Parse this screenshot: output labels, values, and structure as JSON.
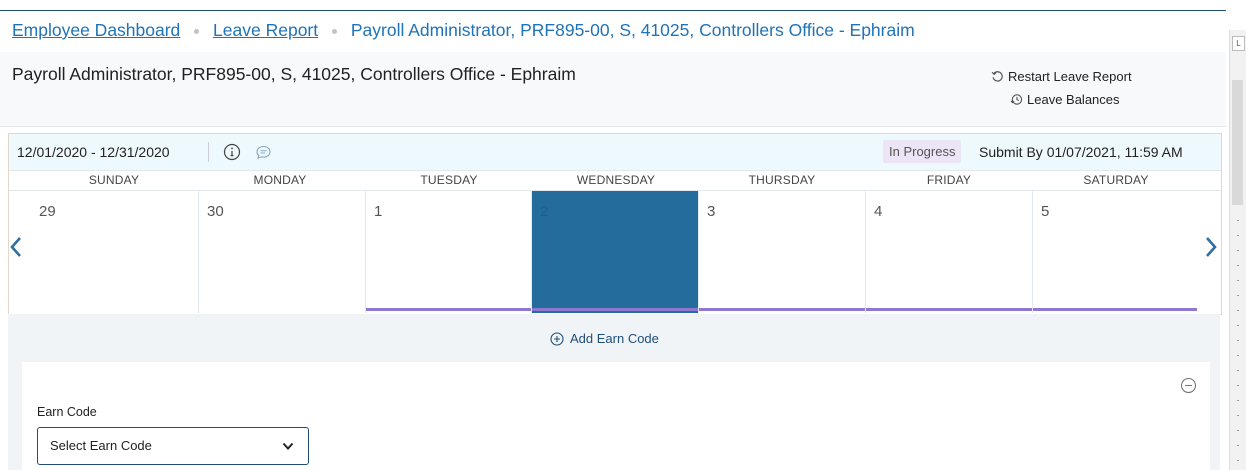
{
  "breadcrumb": {
    "items": [
      "Employee Dashboard",
      "Leave Report"
    ],
    "current": "Payroll Administrator, PRF895-00, S, 41025, Controllers Office - Ephraim"
  },
  "header": {
    "title": "Payroll Administrator, PRF895-00, S, 41025, Controllers Office - Ephraim",
    "restart_label": "Restart Leave Report",
    "balances_label": "Leave Balances"
  },
  "calendar": {
    "period": "12/01/2020 - 12/31/2020",
    "status": "In Progress",
    "submit_by": "Submit By 01/07/2021, 11:59 AM",
    "day_headers": [
      "SUNDAY",
      "MONDAY",
      "TUESDAY",
      "WEDNESDAY",
      "THURSDAY",
      "FRIDAY",
      "SATURDAY"
    ],
    "days": [
      "29",
      "30",
      "1",
      "2",
      "3",
      "4",
      "5"
    ],
    "selected_day": "2"
  },
  "actions": {
    "add_earn_code": "Add Earn Code"
  },
  "earn_form": {
    "label": "Earn Code",
    "select_value": "Select Earn Code"
  },
  "sidebar": {
    "box_label": "L"
  },
  "colors": {
    "link": "#1f73b7",
    "selected_day": "#236c9c",
    "hours_bar": "#8d77d1",
    "status_badge_bg": "#ebe5f6"
  }
}
